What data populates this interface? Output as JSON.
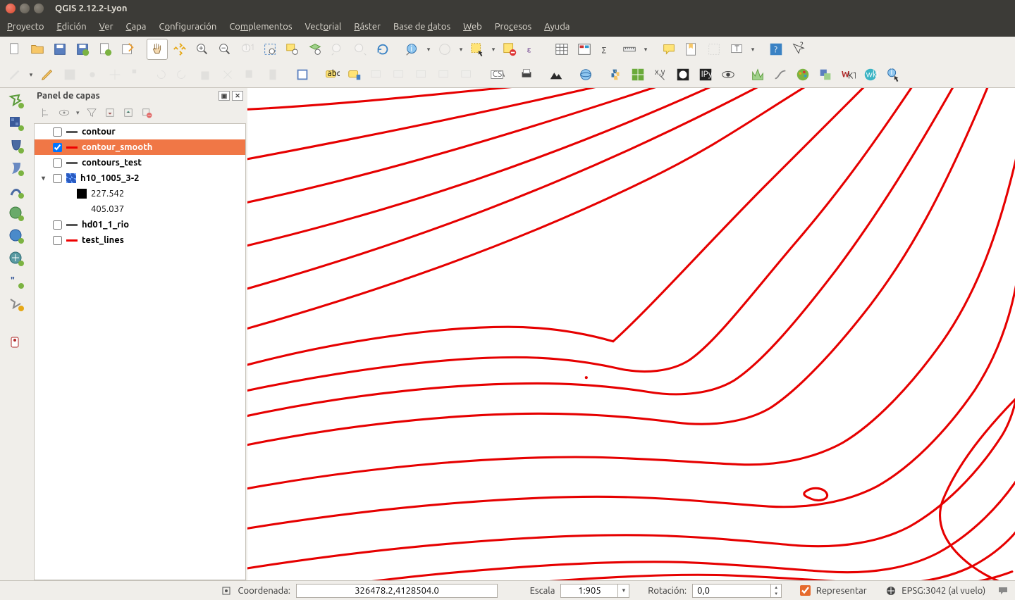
{
  "titlebar": {
    "title": "QGIS 2.12.2-Lyon"
  },
  "menu": {
    "proyecto": "Proyecto",
    "edicion": "Edición",
    "ver": "Ver",
    "capa": "Capa",
    "configuracion": "Configuración",
    "complementos": "Complementos",
    "vectorial": "Vectorial",
    "raster": "Ráster",
    "basedatos": "Base de datos",
    "web": "Web",
    "procesos": "Procesos",
    "ayuda": "Ayuda"
  },
  "layers_panel": {
    "title": "Panel de capas",
    "items": [
      {
        "name": "contour",
        "checked": false,
        "swatch": "line",
        "bold": true
      },
      {
        "name": "contour_smooth",
        "checked": true,
        "swatch": "red",
        "bold": true,
        "selected": true
      },
      {
        "name": "contours_test",
        "checked": false,
        "swatch": "line",
        "bold": true
      },
      {
        "name": "h10_1005_3-2",
        "checked": false,
        "swatch": "multi",
        "bold": true,
        "expand": true
      },
      {
        "name": "227.542",
        "sub": true,
        "swatch": "square"
      },
      {
        "name": "405.037",
        "sub": true,
        "swatch": "none"
      },
      {
        "name": "hd01_1_rio",
        "checked": false,
        "swatch": "line",
        "bold": true
      },
      {
        "name": "test_lines",
        "checked": false,
        "swatch": "red",
        "bold": true
      }
    ]
  },
  "status": {
    "coord_label": "Coordenada:",
    "coord_value": "326478.2,4128504.0",
    "scale_label": "Escala",
    "scale_value": "1:905",
    "rotation_label": "Rotación:",
    "rotation_value": "0,0",
    "render_label": "Representar",
    "epsg_label": "EPSG:3042 (al vuelo)"
  }
}
